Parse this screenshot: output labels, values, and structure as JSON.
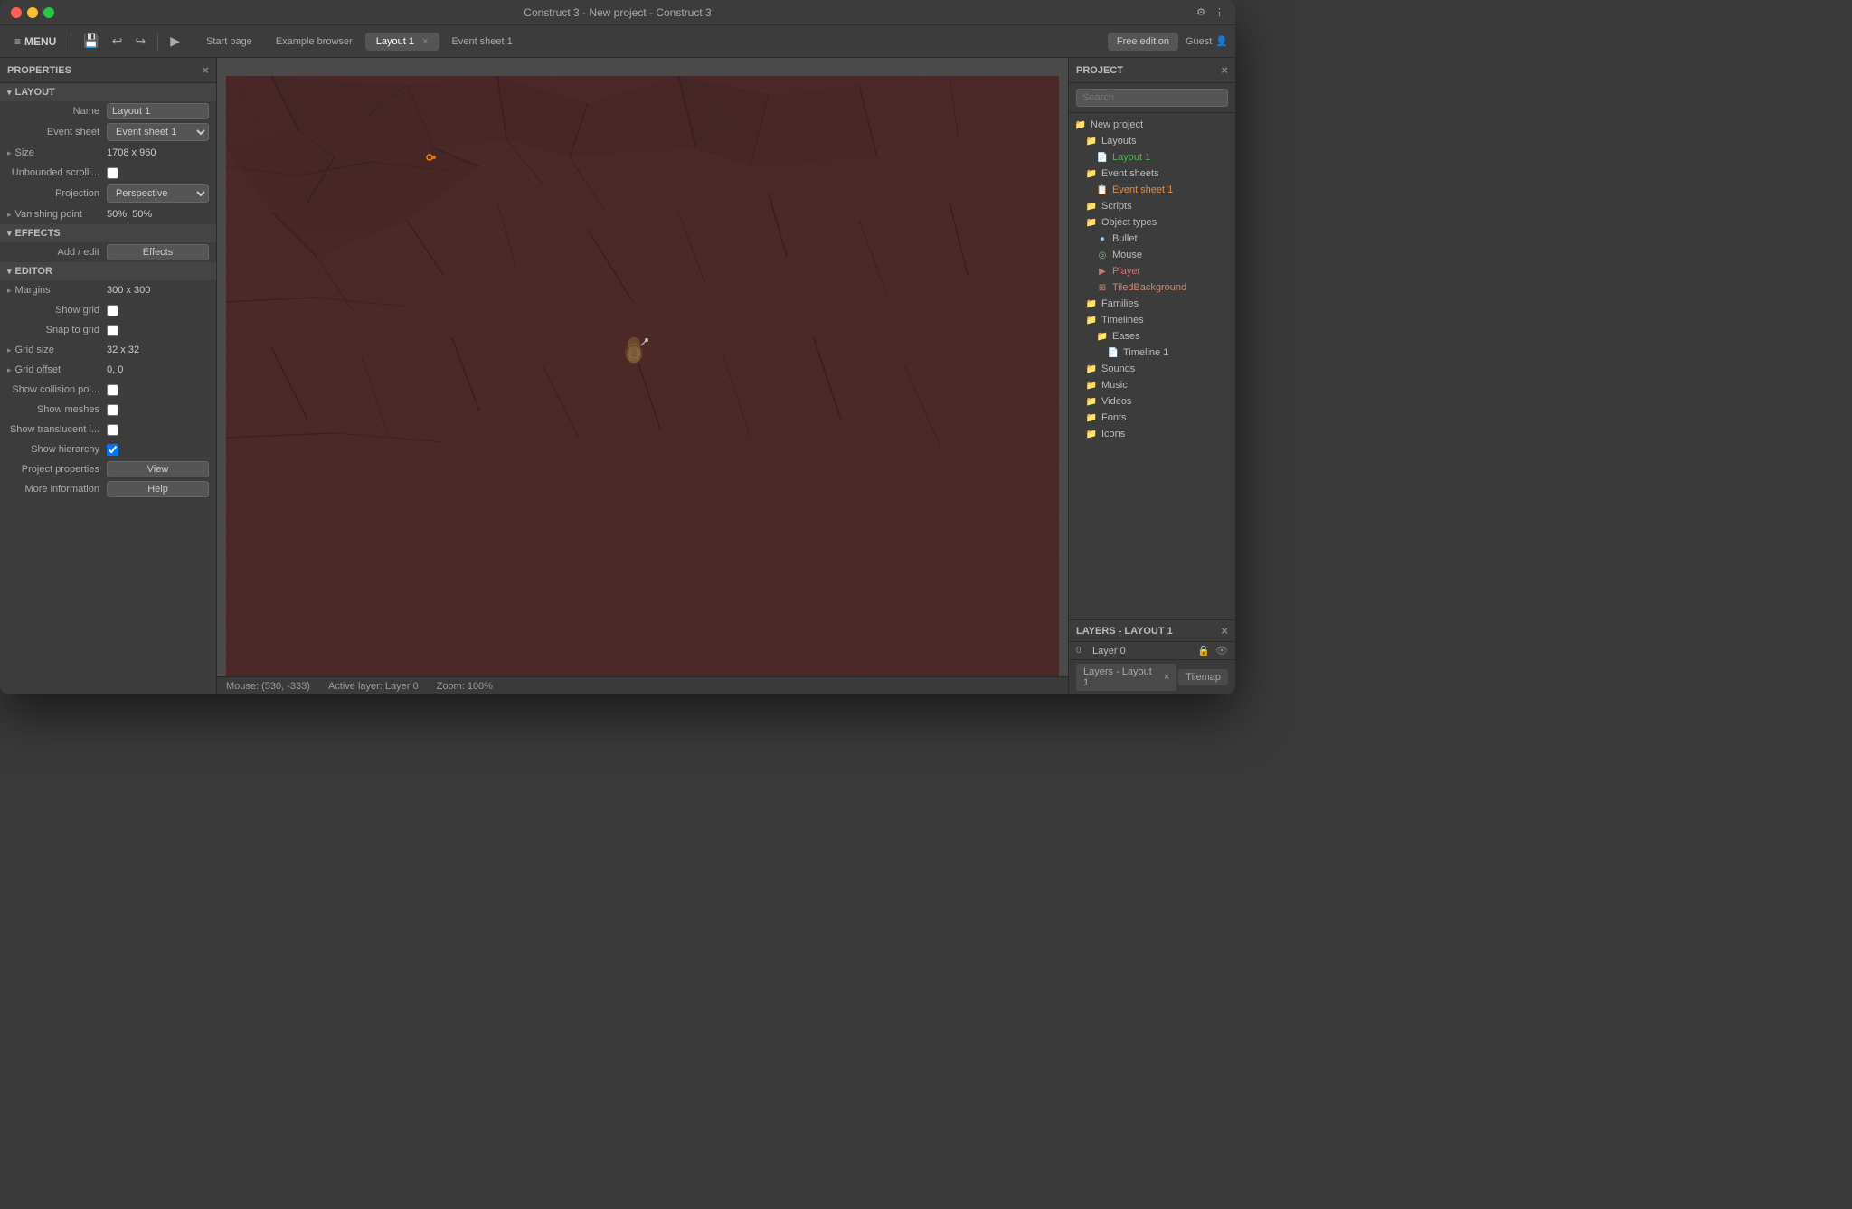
{
  "window": {
    "title": "Construct 3 - New project - Construct 3"
  },
  "titlebar": {
    "close_label": "×",
    "min_label": "−",
    "max_label": "+",
    "settings_icon": "⚙",
    "more_icon": "⋮"
  },
  "toolbar": {
    "menu_label": "MENU",
    "undo_icon": "↩",
    "redo_icon": "↪",
    "play_icon": "▶",
    "tabs": [
      {
        "label": "Start page",
        "active": false
      },
      {
        "label": "Example browser",
        "active": false
      },
      {
        "label": "Layout 1",
        "active": true,
        "closeable": true
      },
      {
        "label": "Event sheet 1",
        "active": false
      }
    ],
    "free_edition": "Free edition",
    "guest": "Guest"
  },
  "properties": {
    "panel_title": "PROPERTIES",
    "sections": {
      "layout": {
        "label": "LAYOUT",
        "name_label": "Name",
        "name_value": "Layout 1",
        "event_sheet_label": "Event sheet",
        "event_sheet_value": "Event sheet 1",
        "size_label": "Size",
        "size_value": "1708 x 960",
        "unbounded_label": "Unbounded scrolli...",
        "projection_label": "Projection",
        "projection_value": "Perspective",
        "vanishing_label": "Vanishing point",
        "vanishing_value": "50%, 50%"
      },
      "effects": {
        "label": "EFFECTS",
        "add_edit_label": "Add / edit",
        "effects_btn": "Effects"
      },
      "editor": {
        "label": "EDITOR",
        "margins_label": "Margins",
        "margins_value": "300 x 300",
        "show_grid_label": "Show grid",
        "snap_to_grid_label": "Snap to grid",
        "grid_size_label": "Grid size",
        "grid_size_value": "32 x 32",
        "grid_offset_label": "Grid offset",
        "grid_offset_value": "0, 0",
        "show_collision_label": "Show collision pol...",
        "show_meshes_label": "Show meshes",
        "show_translucent_label": "Show translucent i...",
        "show_hierarchy_label": "Show hierarchy",
        "project_props_label": "Project properties",
        "view_btn": "View",
        "more_info_label": "More information",
        "help_btn": "Help"
      }
    }
  },
  "project": {
    "panel_title": "PROJECT",
    "search_placeholder": "Search",
    "tree": [
      {
        "indent": 0,
        "type": "folder",
        "label": "New project"
      },
      {
        "indent": 1,
        "type": "folder",
        "label": "Layouts"
      },
      {
        "indent": 2,
        "type": "layout",
        "label": "Layout 1"
      },
      {
        "indent": 1,
        "type": "folder",
        "label": "Event sheets"
      },
      {
        "indent": 2,
        "type": "event",
        "label": "Event sheet 1"
      },
      {
        "indent": 1,
        "type": "folder",
        "label": "Scripts"
      },
      {
        "indent": 1,
        "type": "folder",
        "label": "Object types"
      },
      {
        "indent": 2,
        "type": "bullet",
        "label": "Bullet"
      },
      {
        "indent": 2,
        "type": "mouse",
        "label": "Mouse"
      },
      {
        "indent": 2,
        "type": "player",
        "label": "Player"
      },
      {
        "indent": 2,
        "type": "tiled",
        "label": "TiledBackground"
      },
      {
        "indent": 1,
        "type": "folder",
        "label": "Families"
      },
      {
        "indent": 1,
        "type": "folder",
        "label": "Timelines"
      },
      {
        "indent": 2,
        "type": "folder",
        "label": "Eases"
      },
      {
        "indent": 3,
        "type": "file",
        "label": "Timeline 1"
      },
      {
        "indent": 1,
        "type": "folder",
        "label": "Sounds"
      },
      {
        "indent": 1,
        "type": "folder",
        "label": "Music"
      },
      {
        "indent": 1,
        "type": "folder",
        "label": "Videos"
      },
      {
        "indent": 1,
        "type": "folder",
        "label": "Fonts"
      },
      {
        "indent": 1,
        "type": "folder",
        "label": "Icons"
      }
    ]
  },
  "layers": {
    "panel_title": "LAYERS - LAYOUT 1",
    "layer_num": "0",
    "layer_name": "Layer 0"
  },
  "status_bar": {
    "mouse_pos": "Mouse: (530, -333)",
    "active_layer": "Active layer: Layer 0",
    "zoom": "Zoom: 100%"
  },
  "bottom_tabs": [
    {
      "label": "Layers - Layout 1",
      "closeable": true
    },
    {
      "label": "Tilemap"
    }
  ],
  "icons": {
    "folder": "📁",
    "layout_file": "📄",
    "event_file": "📋",
    "bullet": "•",
    "close": "×",
    "arrow_down": "▾",
    "arrow_right": "▸",
    "lock": "🔒",
    "eye": "👁",
    "hamburger": "≡"
  }
}
